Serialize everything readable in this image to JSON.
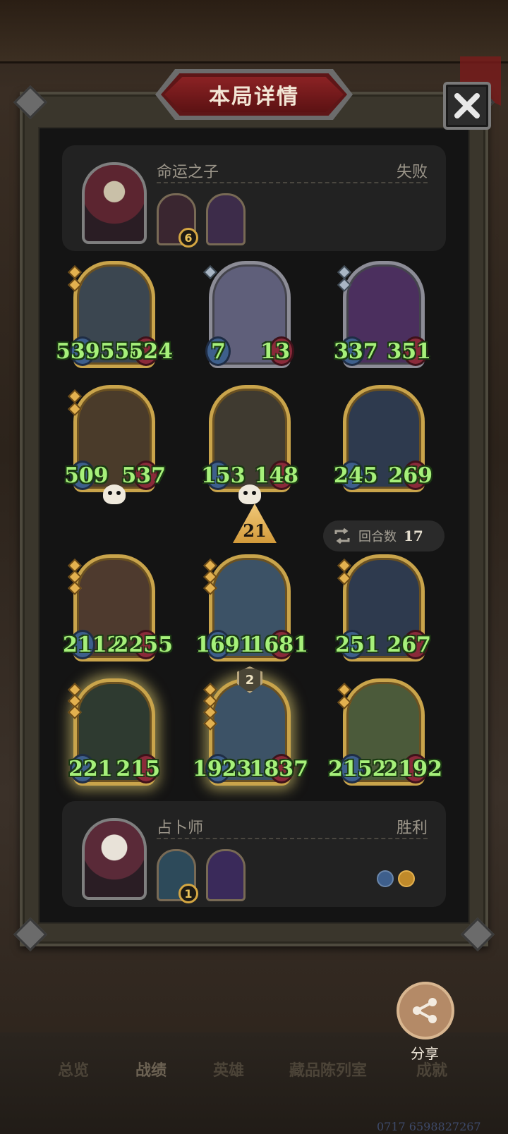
{
  "header": {
    "title": "本局详情",
    "close_label": "✕"
  },
  "top_player": {
    "name": "命运之子",
    "result": "失败",
    "relics": [
      {
        "icon": "dark-relic-icon",
        "badge": "6"
      },
      {
        "icon": "hammer-relic-icon",
        "badge": null
      }
    ]
  },
  "top_board": [
    {
      "atk": "539556",
      "hp": "524",
      "frame": "gold",
      "stars": 2
    },
    {
      "atk": "7",
      "hp": "13",
      "frame": "silver",
      "stars": 1
    },
    {
      "atk": "337",
      "hp": "351",
      "frame": "silver",
      "stars": 2
    },
    {
      "atk": "509",
      "hp": "537",
      "frame": "gold",
      "stars": 2,
      "dead": true
    },
    {
      "atk": "153",
      "hp": "148",
      "frame": "gold",
      "stars": 0,
      "dead": true
    },
    {
      "atk": "245",
      "hp": "269",
      "frame": "gold",
      "stars": 0
    }
  ],
  "middle": {
    "tier_value": "21",
    "turns_label": "回合数",
    "turns_value": "17"
  },
  "bottom_board": [
    {
      "atk": "2112",
      "hp": "2255",
      "frame": "gold",
      "stars": 3
    },
    {
      "atk": "1691",
      "hp": "1681",
      "frame": "gold",
      "stars": 3
    },
    {
      "atk": "251",
      "hp": "267",
      "frame": "gold",
      "stars": 2
    },
    {
      "atk": "221",
      "hp": "215",
      "frame": "gold",
      "stars": 3,
      "glow": true
    },
    {
      "atk": "1923",
      "hp": "1837",
      "frame": "gold",
      "stars": 4,
      "glow": true,
      "badge": "2"
    },
    {
      "atk": "2152",
      "hp": "2192",
      "frame": "gold",
      "stars": 2
    }
  ],
  "bottom_player": {
    "name": "占卜师",
    "result": "胜利",
    "relics": [
      {
        "icon": "card-relic-icon",
        "badge": "1"
      },
      {
        "icon": "portal-relic-icon",
        "badge": null
      }
    ]
  },
  "share": {
    "label": "分享"
  },
  "nav": {
    "tabs": [
      "总览",
      "战绩",
      "英雄",
      "藏品陈列室",
      "成就"
    ],
    "active": "战绩"
  },
  "watermark": "0717 6598827267",
  "colors": {
    "stat_green": "#a6f07a",
    "gold_frame": "#c9a44b",
    "title_red": "#8b2224"
  }
}
